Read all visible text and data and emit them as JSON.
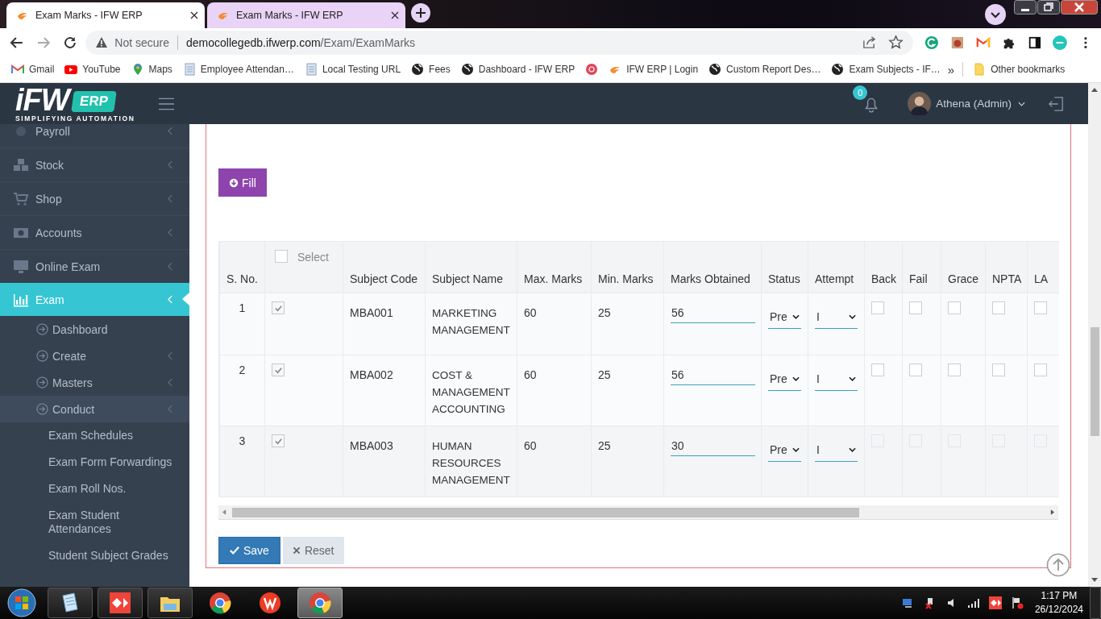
{
  "browser": {
    "tabs": [
      {
        "title": "Exam Marks - IFW ERP",
        "selected": true
      },
      {
        "title": "Exam Marks - IFW ERP",
        "selected": false
      }
    ],
    "address": {
      "security": "Not secure",
      "domain": "democollegedb.ifwerp.com",
      "path": "/Exam/ExamMarks"
    },
    "bookmarks": [
      {
        "label": "Gmail",
        "kind": "gmail"
      },
      {
        "label": "YouTube",
        "kind": "youtube"
      },
      {
        "label": "Maps",
        "kind": "maps"
      },
      {
        "label": "Employee Attendan…",
        "kind": "doc"
      },
      {
        "label": "Local Testing URL",
        "kind": "doc"
      },
      {
        "label": "Fees",
        "kind": "globe"
      },
      {
        "label": "Dashboard - IFW ERP",
        "kind": "globe"
      },
      {
        "kind": "red"
      },
      {
        "label": "IFW ERP | Login",
        "kind": "ifw"
      },
      {
        "label": "Custom Report Des…",
        "kind": "globe"
      },
      {
        "label": "Exam Subjects - IF…",
        "kind": "globe"
      }
    ],
    "overflow": "»",
    "other": "Other bookmarks"
  },
  "header": {
    "notifications": "0",
    "user": "Athena (Admin)"
  },
  "logo": {
    "brand": "iFW",
    "badge": "ERP",
    "tagline": "SIMPLIFYING AUTOMATION"
  },
  "sidebar": {
    "items": [
      {
        "label": "Payroll",
        "kind": "payroll",
        "expandable": true,
        "active": false
      },
      {
        "label": "Stock",
        "kind": "stock",
        "expandable": true,
        "active": false
      },
      {
        "label": "Shop",
        "kind": "shop",
        "expandable": true,
        "active": false
      },
      {
        "label": "Accounts",
        "kind": "accounts",
        "expandable": true,
        "active": false
      },
      {
        "label": "Online Exam",
        "kind": "monitor",
        "expandable": true,
        "active": false
      },
      {
        "label": "Exam",
        "kind": "chart",
        "expandable": true,
        "active": true,
        "children": [
          {
            "label": "Dashboard",
            "expandable": false,
            "active": false
          },
          {
            "label": "Create",
            "expandable": true,
            "active": false
          },
          {
            "label": "Masters",
            "expandable": true,
            "active": false
          },
          {
            "label": "Conduct",
            "expandable": true,
            "active": true,
            "children": [
              {
                "label": "Exam Schedules",
                "active": false
              },
              {
                "label": "Exam Form Forwardings",
                "active": false
              },
              {
                "label": "Exam Roll Nos.",
                "active": false
              },
              {
                "label": "Exam Student Attendances",
                "active": false
              },
              {
                "label": "Student Subject Grades",
                "active": false
              }
            ]
          }
        ]
      }
    ]
  },
  "content": {
    "fill_button": "Fill",
    "table": {
      "columns": [
        {
          "label": "S. No.",
          "kind": "text"
        },
        {
          "label": "Select",
          "kind": "select_all",
          "checked": false
        },
        {
          "label": "Subject Code",
          "kind": "text"
        },
        {
          "label": "Subject Name",
          "kind": "text"
        },
        {
          "label": "Max. Marks",
          "kind": "text"
        },
        {
          "label": "Min. Marks",
          "kind": "text"
        },
        {
          "label": "Marks Obtained",
          "kind": "text"
        },
        {
          "label": "Status",
          "kind": "text"
        },
        {
          "label": "Attempt",
          "kind": "text"
        },
        {
          "label": "Back",
          "kind": "text"
        },
        {
          "label": "Fail",
          "kind": "text"
        },
        {
          "label": "Grace",
          "kind": "text"
        },
        {
          "label": "NPTA",
          "kind": "text"
        },
        {
          "label": "LA",
          "kind": "text"
        }
      ],
      "rows": [
        {
          "sno": "1",
          "selected": true,
          "code": "MBA001",
          "name": "MARKETING MANAGEMENT",
          "max": "60",
          "min": "25",
          "marks": "56",
          "status": "Pre",
          "attempt": "I",
          "flags": [
            {
              "checked": false,
              "disabled": false
            },
            {
              "checked": false,
              "disabled": false
            },
            {
              "checked": false,
              "disabled": false
            },
            {
              "checked": false,
              "disabled": false
            },
            {
              "checked": false,
              "disabled": false
            }
          ]
        },
        {
          "sno": "2",
          "selected": true,
          "code": "MBA002",
          "name": "COST & MANAGEMENT ACCOUNTING",
          "max": "60",
          "min": "25",
          "marks": "56",
          "status": "Pre",
          "attempt": "I",
          "flags": [
            {
              "checked": false,
              "disabled": false
            },
            {
              "checked": false,
              "disabled": false
            },
            {
              "checked": false,
              "disabled": false
            },
            {
              "checked": false,
              "disabled": false
            },
            {
              "checked": false,
              "disabled": false
            }
          ]
        },
        {
          "sno": "3",
          "selected": true,
          "code": "MBA003",
          "name": "HUMAN RESOURCES MANAGEMENT",
          "max": "60",
          "min": "25",
          "marks": "30",
          "status": "Pre",
          "attempt": "I",
          "flags": [
            {
              "checked": false,
              "disabled": true
            },
            {
              "checked": false,
              "disabled": true
            },
            {
              "checked": false,
              "disabled": true
            },
            {
              "checked": false,
              "disabled": true
            },
            {
              "checked": false,
              "disabled": true
            }
          ]
        }
      ]
    },
    "save_button": "Save",
    "reset_button": "Reset"
  },
  "taskbar": {
    "apps": [
      {
        "kind": "notepad",
        "running": true,
        "selected": false
      },
      {
        "kind": "anydesk",
        "running": true,
        "selected": false
      },
      {
        "kind": "explorer",
        "running": true,
        "selected": false
      },
      {
        "kind": "chrome",
        "running": false,
        "selected": false
      },
      {
        "kind": "wps",
        "running": false,
        "selected": false
      },
      {
        "kind": "chrome",
        "running": true,
        "selected": true
      }
    ],
    "time": "1:17 PM",
    "date": "26/12/2024"
  }
}
